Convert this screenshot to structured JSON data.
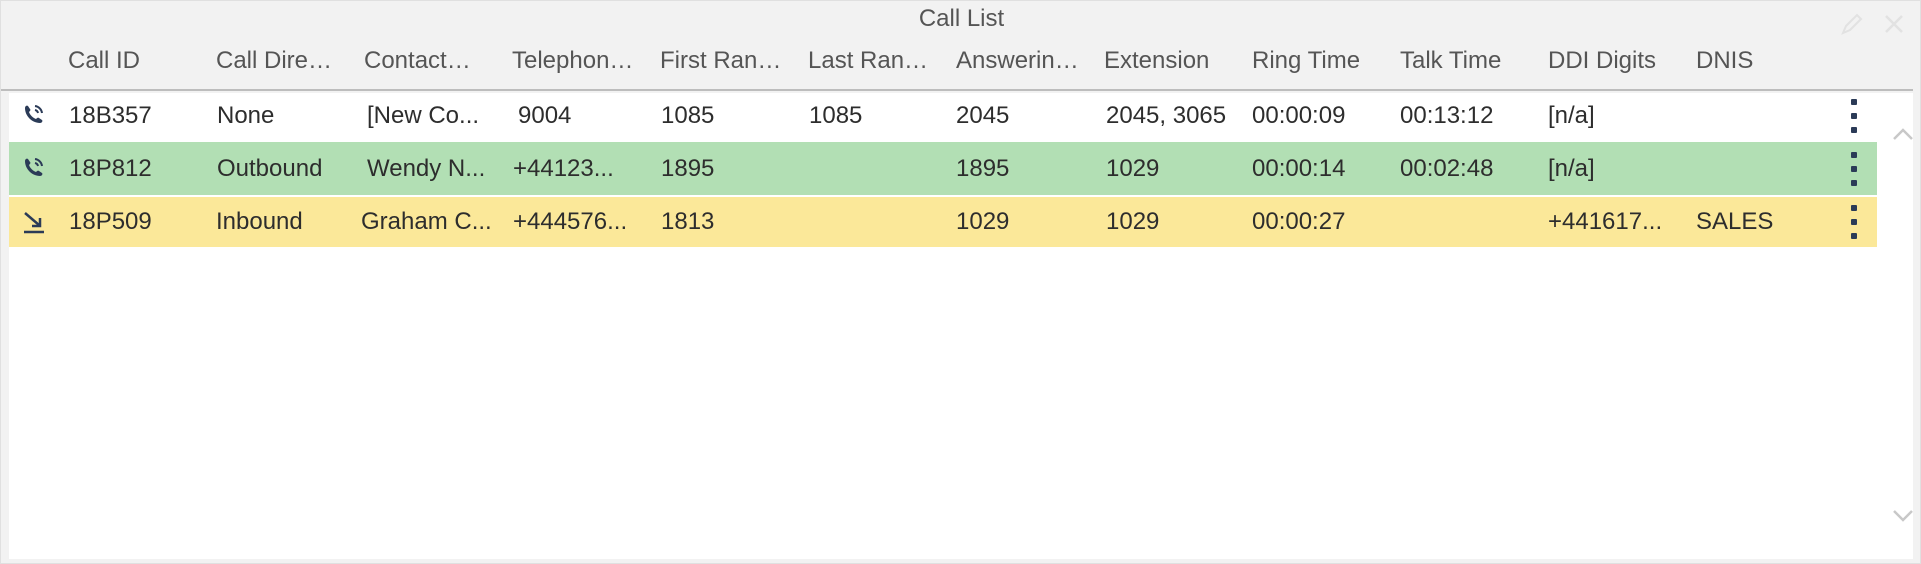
{
  "window": {
    "title": "Call List",
    "edit_icon": "pencil-icon",
    "close_icon": "close-icon"
  },
  "columns": [
    {
      "key": "call_id",
      "label": "Call ID"
    },
    {
      "key": "call_direction",
      "label": "Call Dire…"
    },
    {
      "key": "contact",
      "label": "Contact…"
    },
    {
      "key": "telephone",
      "label": "Telephon…"
    },
    {
      "key": "first_rang",
      "label": "First Ran…"
    },
    {
      "key": "last_rang",
      "label": "Last Ran…"
    },
    {
      "key": "answering",
      "label": "Answerin…"
    },
    {
      "key": "extension",
      "label": "Extension"
    },
    {
      "key": "ring_time",
      "label": "Ring Time"
    },
    {
      "key": "talk_time",
      "label": "Talk Time"
    },
    {
      "key": "ddi_digits",
      "label": "DDI Digits"
    },
    {
      "key": "dnis",
      "label": "DNIS"
    }
  ],
  "rows": [
    {
      "icon": "phone-ringing-icon",
      "status_color": "#ffffff",
      "call_id": "18B357",
      "call_direction": "None",
      "contact": "[New Co...",
      "telephone": "9004",
      "first_rang": "1085",
      "last_rang": "1085",
      "answering": "2045",
      "extension": "2045, 3065",
      "ring_time": "00:00:09",
      "talk_time": "00:13:12",
      "ddi_digits": "[n/a]",
      "dnis": ""
    },
    {
      "icon": "phone-ringing-icon",
      "status_color": "#b2dfb4",
      "call_id": "18P812",
      "call_direction": "Outbound",
      "contact": "Wendy N...",
      "telephone": "+44123...",
      "first_rang": "1895",
      "last_rang": "",
      "answering": "1895",
      "extension": "1029",
      "ring_time": "00:00:14",
      "talk_time": "00:02:48",
      "ddi_digits": "[n/a]",
      "dnis": ""
    },
    {
      "icon": "inbound-arrow-icon",
      "status_color": "#fbe899",
      "call_id": "18P509",
      "call_direction": "Inbound",
      "contact": "Graham C...",
      "telephone": "+444576...",
      "first_rang": "1813",
      "last_rang": "",
      "answering": "1029",
      "extension": "1029",
      "ring_time": "00:00:27",
      "talk_time": "",
      "ddi_digits": "+441617...",
      "dnis": "SALES"
    }
  ],
  "row_menu_icon": "kebab-menu-icon",
  "scroll": {
    "up_icon": "chevron-up-icon",
    "down_icon": "chevron-down-icon"
  }
}
